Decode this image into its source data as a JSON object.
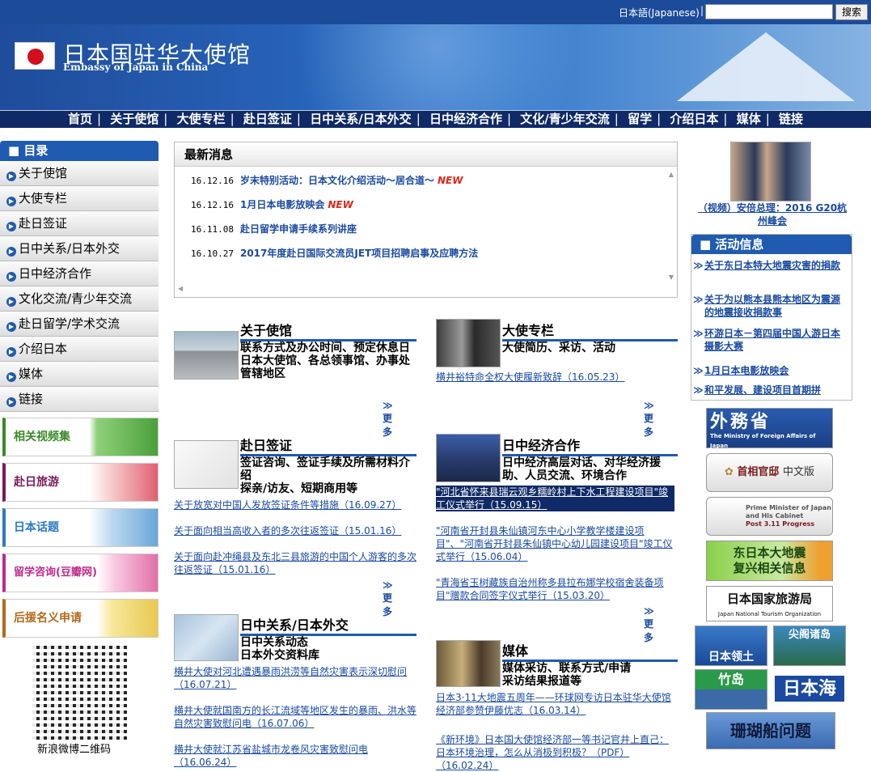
{
  "topbar": {
    "lang": "日本語(Japanese)",
    "search_placeholder": "",
    "search_button": "搜索"
  },
  "banner": {
    "title": "日本国驻华大使馆",
    "subtitle": "Embassy of Japan in China"
  },
  "nav": [
    "首页",
    "关于使馆",
    "大使专栏",
    "赴日签证",
    "日中关系/日本外交",
    "日中经济合作",
    "文化/青少年交流",
    "留学",
    "介绍日本",
    "媒体",
    "链接"
  ],
  "sidebar": {
    "title": "目录",
    "items": [
      "关于使馆",
      "大使专栏",
      "赴日签证",
      "日中关系/日本外交",
      "日中经济合作",
      "文化交流/青少年交流",
      "赴日留学/学术交流",
      "介绍日本",
      "媒体",
      "链接"
    ],
    "banners": [
      "相关视频集",
      "赴日旅游",
      "日本话题",
      "留学咨询(豆瓣网)",
      "后援名义申请"
    ],
    "qr_caption": "新浪微博二维码"
  },
  "news": {
    "title": "最新消息",
    "new_label": "NEW",
    "items": [
      {
        "date": "16.12.16",
        "text": "岁末特别活动：日本文化介绍活动～居合道～",
        "new": true
      },
      {
        "date": "16.12.16",
        "text": "1月日本电影放映会",
        "new": true
      },
      {
        "date": "16.11.08",
        "text": "赴日留学申请手续系列讲座",
        "new": false
      },
      {
        "date": "16.10.27",
        "text": "2017年度赴日国际交流员JET项目招聘启事及应聘方法",
        "new": false
      }
    ]
  },
  "more_label": "更多",
  "sections": {
    "embassy": {
      "title": "关于使馆",
      "desc": "联系方式及办公时间、预定休息日\n日本大使馆、各总领事馆、办事处管辖地区"
    },
    "ambassador": {
      "title": "大使专栏",
      "desc": "大使简历、采访、活动",
      "links": [
        "横井裕特命全权大使履新致辞（16.05.23）"
      ]
    },
    "visa": {
      "title": "赴日签证",
      "desc": "签证咨询、签证手续及所需材料介绍\n探亲/访友、短期商用等",
      "links": [
        "关于放宽对中国人发放签证条件等措施（16.09.27）",
        "关于面向相当高收入者的多次往返签证（15.01.16）",
        "关于面向赴冲绳县及东北三县旅游的中国个人游客的多次往返签证（15.01.16）"
      ]
    },
    "economy": {
      "title": "日中经济合作",
      "desc": "日中经济高层对话、对华经济援助、人员交流、环境合作",
      "links": [
        "\"河北省怀来县瑞云观乡糯岭村上下水工程建设项目\"竣工仪式举行（15.09.15）",
        "\"河南省开封县朱仙镇河东中心小学教学楼建设项目\"、\"河南省开封县朱仙镇中心幼儿园建设项目\"竣工仪式举行（15.06.04）",
        "\"青海省玉树藏族自治州称多县拉布娜学校宿舍装备项目\"赠款合同签字仪式举行（15.03.20）"
      ]
    },
    "relations": {
      "title": "日中关系/日本外交",
      "desc": "日中关系动态\n日本外交资料库",
      "links": [
        "横井大使对河北遭遇暴雨洪涝等自然灾害表示深切慰问（16.07.21）",
        "横井大使就国南方的长江流域等地区发生的暴雨、洪水等自然灾害致慰问电（16.07.06）",
        "横井大使就江苏省盐城市龙卷风灾害致慰问电（16.06.24）"
      ]
    },
    "media": {
      "title": "媒体",
      "desc": "媒体采访、联系方式/申请\n采访结果报道等",
      "links": [
        "日本3·11大地震五周年——环球网专访日本驻华大使馆经济部参赞伊藤优志（16.03.14）",
        "《新环境》日本国大使馆经济部一等书记官井上直己：日本环境治理，怎么从消极到积极？（PDF）（16.02.24）"
      ]
    }
  },
  "right": {
    "photo_caption": "（视频）安倍总理：2016 G20杭州峰会",
    "activity_title": "活动信息",
    "activity_items": [
      "关于东日本特大地震灾害的捐款",
      "关于为以熊本县熊本地区为震源的地震接收捐款事",
      "环游日本－第四届中国人游日本摄影大赛",
      "1月日本电影放映会",
      "和平发展、建设项目首期拼"
    ],
    "mofa": {
      "jp": "外務省",
      "en": "The Ministry of Foreign Affairs of Japan"
    },
    "kantei": {
      "name": "首相官邸",
      "lang": "中文版"
    },
    "pm": {
      "line1": "Prime Minister of Japan",
      "line2": "and His Cabinet",
      "line3": "Post 3.11 Progress"
    },
    "recovery": {
      "line1": "东日本大地震",
      "line2": "复兴相关信息"
    },
    "jnto": {
      "name": "日本国家旅游局",
      "en": "Japan National Tourism Organization"
    },
    "territory": "日本领土",
    "senkaku": "尖阁诸岛",
    "takeshima": "竹岛",
    "sea": "日本海",
    "coral": "珊瑚船问题"
  }
}
